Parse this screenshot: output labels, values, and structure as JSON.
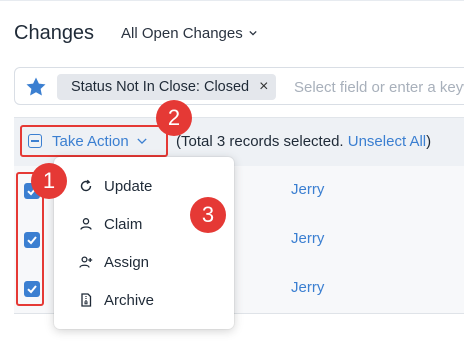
{
  "page": {
    "title": "Changes"
  },
  "view_select": {
    "label": "All Open Changes",
    "icon": "chevron-down-icon"
  },
  "filter_bar": {
    "chip_label": "Status Not In Close: Closed",
    "chip_close": "×",
    "placeholder": "Select field or enter a keyword"
  },
  "action_bar": {
    "take_action_label": "Take Action",
    "selection_prefix": "(Total 3 records selected. ",
    "unselect_label": "Unselect All",
    "selection_suffix": ")"
  },
  "rows": [
    {
      "checked": true,
      "name": "Jerry"
    },
    {
      "checked": true,
      "name": "Jerry"
    },
    {
      "checked": true,
      "name": "Jerry"
    }
  ],
  "menu": {
    "items": [
      {
        "label": "Update",
        "icon": "refresh-icon"
      },
      {
        "label": "Claim",
        "icon": "user-icon"
      },
      {
        "label": "Assign",
        "icon": "user-plus-icon"
      },
      {
        "label": "Archive",
        "icon": "archive-file-icon"
      }
    ]
  },
  "annotations": {
    "badge_1": "1",
    "badge_2": "2",
    "badge_3": "3"
  },
  "colors": {
    "accent": "#3b7fd1",
    "annotation_red": "#e53935",
    "chip_bg": "#e4e7ec"
  }
}
